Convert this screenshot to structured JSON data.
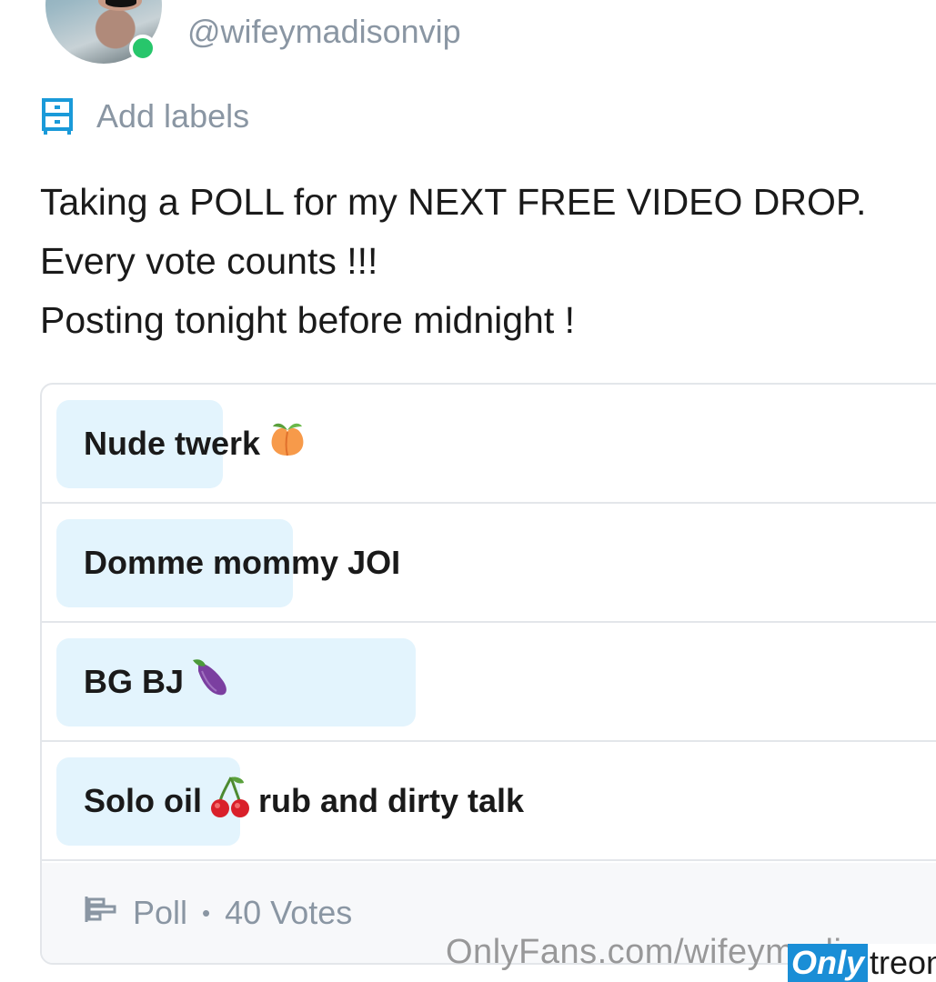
{
  "profile": {
    "handle": "@wifeymadisonvip",
    "online": true,
    "online_color": "#27c66b"
  },
  "labels": {
    "icon": "label-drawer-icon",
    "text": "Add labels"
  },
  "post": {
    "lines": [
      "Taking a POLL for my NEXT FREE VIDEO DROP.",
      "Every vote counts !!!",
      "Posting tonight before midnight !"
    ]
  },
  "poll": {
    "options": [
      {
        "text": "Nude twerk",
        "emoji": "peach",
        "text_after": "",
        "percent": 19
      },
      {
        "text": "Domme mommy JOI",
        "emoji": "",
        "text_after": "",
        "percent": 27
      },
      {
        "text": "BG BJ",
        "emoji": "eggplant",
        "text_after": "",
        "percent": 41
      },
      {
        "text": "Solo oil",
        "emoji": "cherries",
        "text_after": "rub and dirty talk",
        "percent": 21
      }
    ],
    "footer": {
      "type_label": "Poll",
      "votes_label": "40 Votes"
    },
    "fill_color": "#e3f4fd"
  },
  "watermark": {
    "text": "OnlyFans.com/wifeymadison",
    "logo_part1": "Only",
    "logo_part2": "treon"
  }
}
